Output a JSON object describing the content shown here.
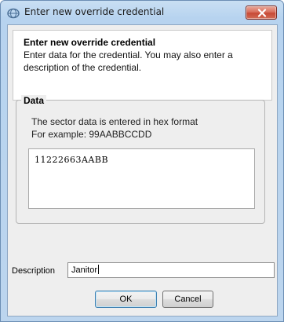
{
  "window": {
    "title": "Enter new override credential",
    "title_icon": "globe-key-icon",
    "close_icon": "close-icon"
  },
  "header": {
    "title": "Enter new override credential",
    "description": "Enter data for the credential. You may also enter a description of the credential."
  },
  "data_group": {
    "label": "Data",
    "info_line1": "The sector data is entered in hex format",
    "info_line2": "For example: 99AABBCCDD",
    "hex_value": "11222663AABB"
  },
  "description": {
    "label": "Description",
    "value": "Janitor"
  },
  "buttons": {
    "ok": "OK",
    "cancel": "Cancel"
  },
  "colors": {
    "titlebar": "#bcd5ee",
    "close_button": "#c74a36",
    "dialog_background": "#eeeeee"
  }
}
